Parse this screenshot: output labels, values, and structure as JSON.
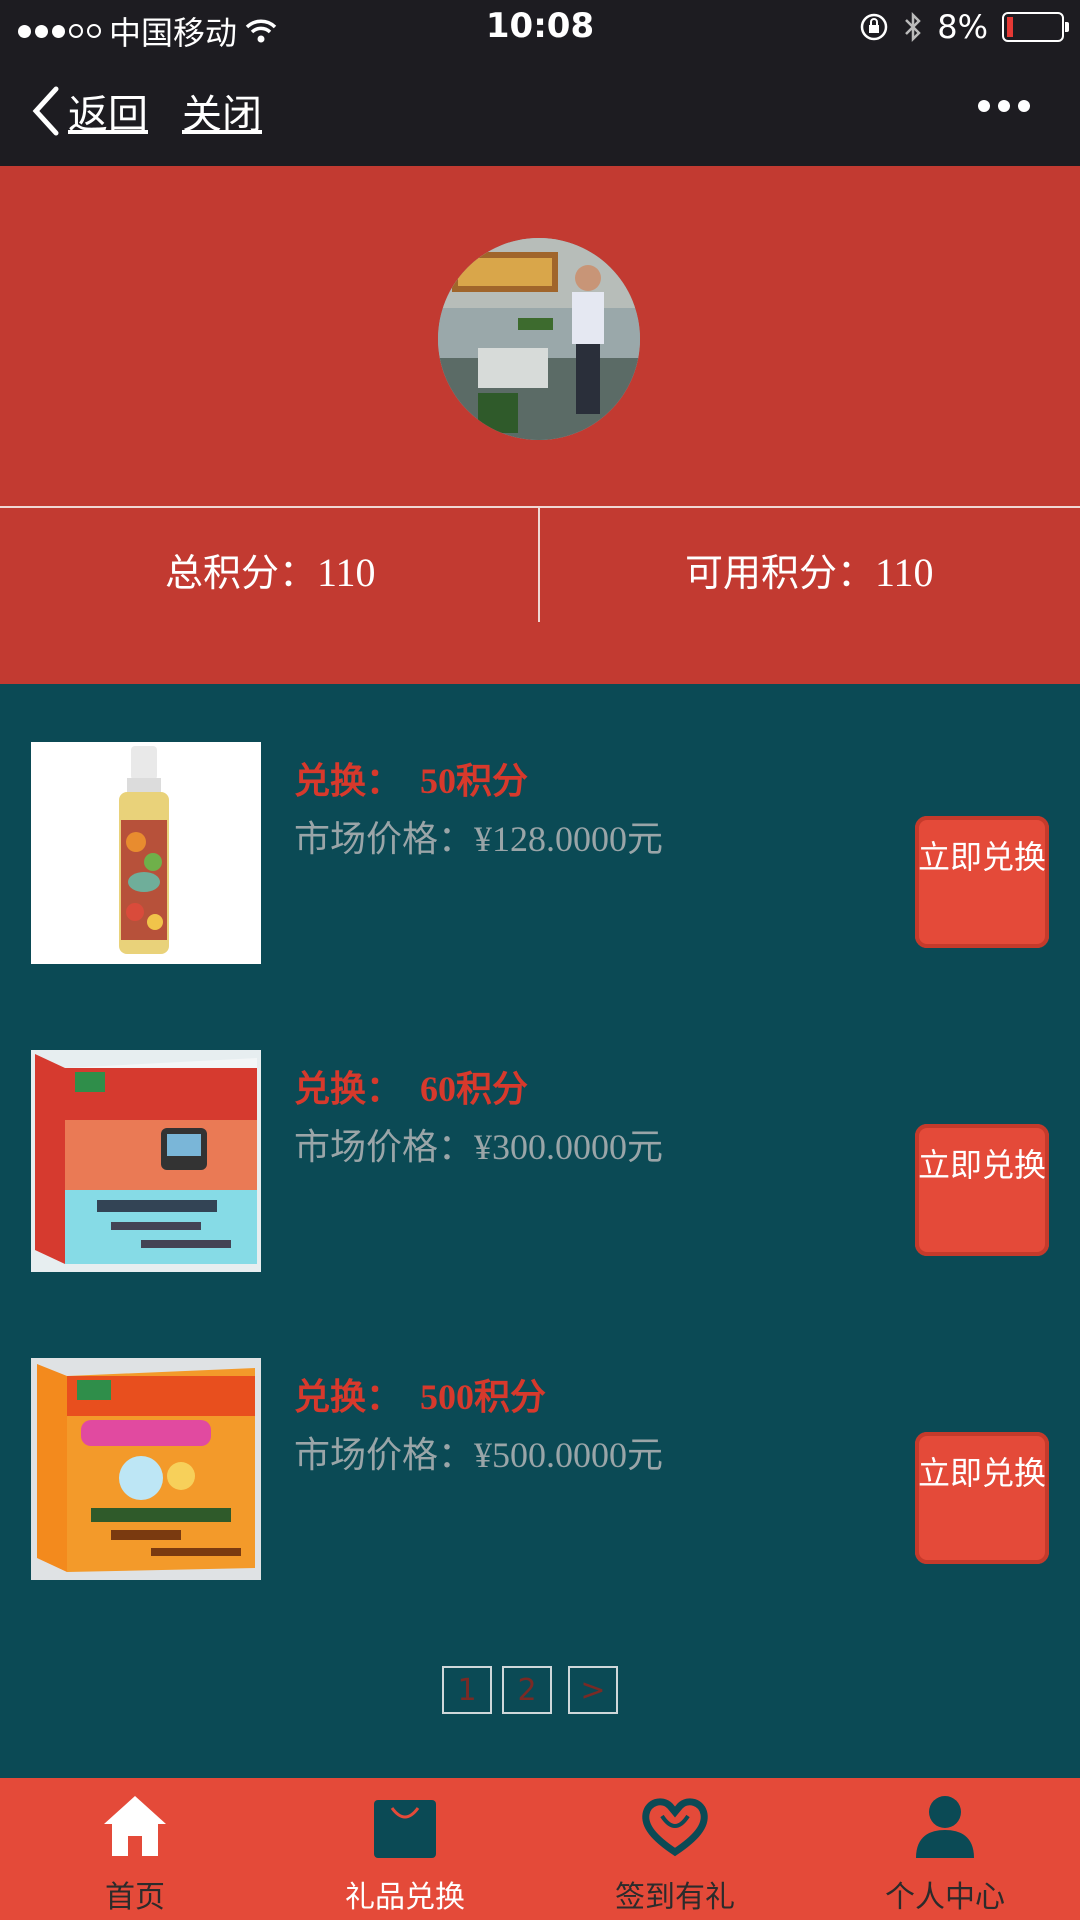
{
  "status_bar": {
    "carrier": "中国移动",
    "time": "10:08",
    "battery": "8%"
  },
  "nav": {
    "back_label": "返回",
    "close_label": "关闭"
  },
  "points": {
    "total_label": "总积分：",
    "total_value": "110",
    "available_label": "可用积分：",
    "available_value": "110"
  },
  "products": [
    {
      "exchange_label": "兑换：",
      "points": "50积分",
      "market_label": "市场价格：",
      "price": "¥128.0000元",
      "button": "立即兑换"
    },
    {
      "exchange_label": "兑换：",
      "points": "60积分",
      "market_label": "市场价格：",
      "price": "¥300.0000元",
      "button": "立即兑换"
    },
    {
      "exchange_label": "兑换：",
      "points": "500积分",
      "market_label": "市场价格：",
      "price": "¥500.0000元",
      "button": "立即兑换"
    }
  ],
  "pagination": {
    "pages": [
      "1",
      "2"
    ],
    "next": ">"
  },
  "tabbar": [
    {
      "label": "首页",
      "icon": "home-icon"
    },
    {
      "label": "礼品兑换",
      "icon": "shopping-bag-icon"
    },
    {
      "label": "签到有礼",
      "icon": "heart-icon"
    },
    {
      "label": "个人中心",
      "icon": "person-icon"
    }
  ],
  "colors": {
    "header_red": "#c23a31",
    "body_teal": "#0b4a55",
    "tab_red": "#e44a39",
    "accent_text": "#d7392c"
  }
}
